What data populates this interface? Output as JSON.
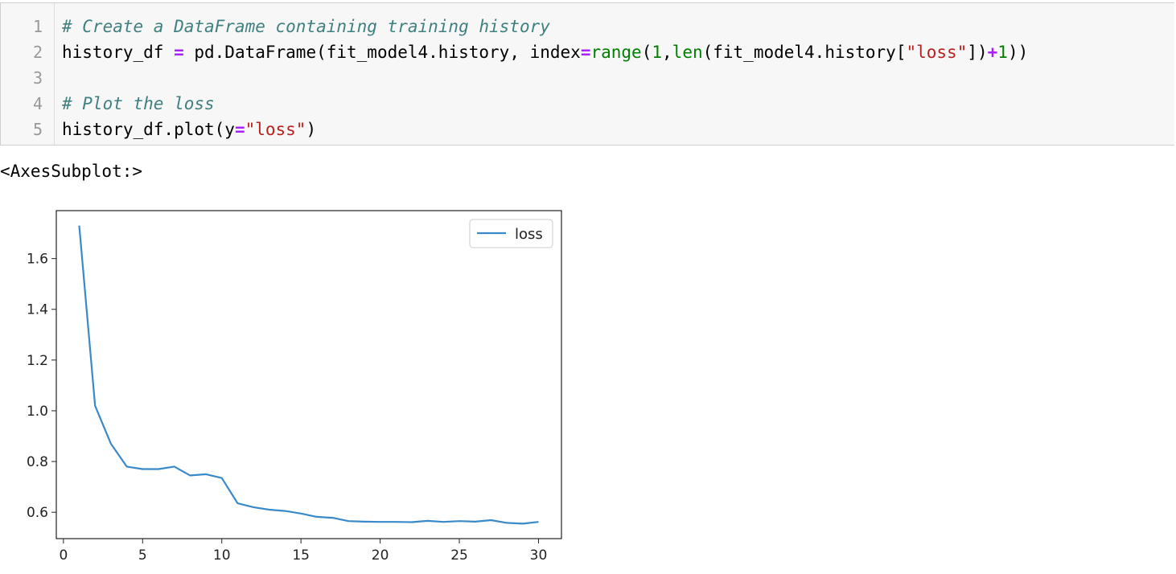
{
  "code_cell": {
    "line_numbers": [
      "1",
      "2",
      "3",
      "4",
      "5"
    ],
    "line1": {
      "comment": "# Create a DataFrame containing training history"
    },
    "line2": {
      "t1": "history_df ",
      "op1": "=",
      "t2": " pd.DataFrame(fit_model4.history, index",
      "op2": "=",
      "b1": "range",
      "t3": "(",
      "n1": "1",
      "t4": ",",
      "b2": "len",
      "t5": "(fit_model4.history[",
      "s1": "\"loss\"",
      "t6": "])",
      "op3": "+",
      "n2": "1",
      "t7": "))"
    },
    "line4": {
      "comment": "# Plot the loss"
    },
    "line5": {
      "t1": "history_df.plot(y",
      "op1": "=",
      "s1": "\"loss\"",
      "t2": ")"
    }
  },
  "output": {
    "repr": "<AxesSubplot:>"
  },
  "colors": {
    "line": "#3a89c9",
    "comment": "#408080",
    "operator": "#aa22ff",
    "builtin": "#008000",
    "string": "#ba2121"
  },
  "chart_data": {
    "type": "line",
    "x": [
      1,
      2,
      3,
      4,
      5,
      6,
      7,
      8,
      9,
      10,
      11,
      12,
      13,
      14,
      15,
      16,
      17,
      18,
      19,
      20,
      21,
      22,
      23,
      24,
      25,
      26,
      27,
      28,
      29,
      30
    ],
    "series": [
      {
        "name": "loss",
        "values": [
          1.73,
          1.02,
          0.87,
          0.78,
          0.77,
          0.77,
          0.78,
          0.745,
          0.75,
          0.735,
          0.635,
          0.62,
          0.61,
          0.605,
          0.595,
          0.582,
          0.578,
          0.565,
          0.563,
          0.562,
          0.562,
          0.561,
          0.566,
          0.562,
          0.565,
          0.563,
          0.569,
          0.558,
          0.555,
          0.562
        ]
      }
    ],
    "xticks": [
      "0",
      "5",
      "10",
      "15",
      "20",
      "25",
      "30"
    ],
    "yticks": [
      "0.6",
      "0.8",
      "1.0",
      "1.2",
      "1.4",
      "1.6"
    ],
    "xlim": [
      -0.45,
      31.45
    ],
    "ylim": [
      0.496,
      1.789
    ],
    "legend": "top-right",
    "grid": false
  }
}
